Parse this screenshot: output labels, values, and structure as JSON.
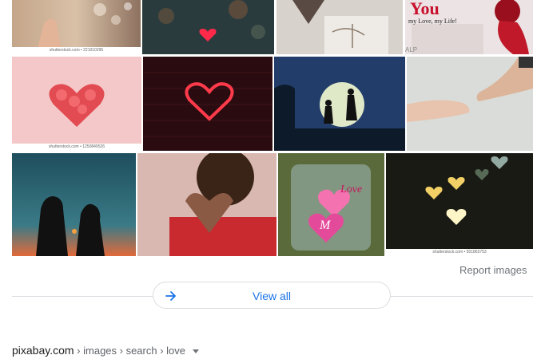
{
  "images": [
    {
      "id": "img-hand-bokeh",
      "alt": "Hand with bubbles bokeh",
      "watermark": "shutterstock.com • 221010295"
    },
    {
      "id": "img-bokeh-heart",
      "alt": "Red bokeh heart",
      "watermark": ""
    },
    {
      "id": "img-gift-string",
      "alt": "Gift tied with string",
      "watermark": ""
    },
    {
      "id": "img-love-you-card",
      "alt": "Love you card with red rose",
      "caption_big": "You",
      "caption_small": "my Love, my Life!",
      "corner_text": "ALP",
      "watermark": ""
    },
    {
      "id": "img-rose-heart",
      "alt": "Heart made of pink roses",
      "watermark": "shutterstock.com • 1250849526"
    },
    {
      "id": "img-neon-heart",
      "alt": "Neon heart on brick wall",
      "watermark": ""
    },
    {
      "id": "img-proposal-moon",
      "alt": "Proposal silhouette under moon",
      "watermark": ""
    },
    {
      "id": "img-pinky-promise",
      "alt": "Pinky promise hands",
      "watermark": ""
    },
    {
      "id": "img-couple-sunset",
      "alt": "Couple silhouette at sunset",
      "watermark": ""
    },
    {
      "id": "img-heart-hands",
      "alt": "Woman making heart with hands",
      "watermark": ""
    },
    {
      "id": "img-love-jar",
      "alt": "Glass jar with love hearts",
      "jar_text_1": "Love",
      "jar_text_2": "M",
      "watermark": ""
    },
    {
      "id": "img-gold-hearts",
      "alt": "Golden bokeh hearts",
      "watermark": "shutterstock.com • 551863753"
    }
  ],
  "report_images": "Report images",
  "view_all": "View all",
  "breadcrumb": {
    "site": "pixabay.com",
    "path": " › images › search › love"
  },
  "colors": {
    "link_blue": "#1a73e8",
    "divider": "#dadce0",
    "muted": "#70757a"
  }
}
